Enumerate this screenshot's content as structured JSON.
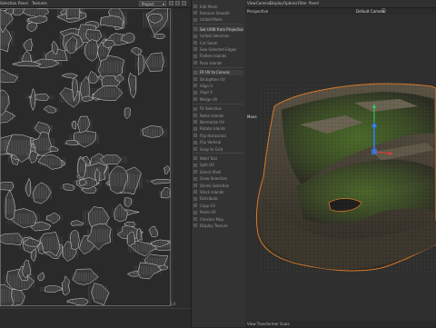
{
  "uv_editor": {
    "menu": [
      "Selection",
      "Panel",
      "Textures"
    ],
    "dropdown_value": "Project",
    "coord_label": "1.0"
  },
  "tools": [
    {
      "label": "Edit Mesh",
      "highlight": false
    },
    {
      "label": "Remove Smooth",
      "highlight": false
    },
    {
      "label": "Unfold Mesh",
      "highlight": false
    },
    {
      "label": "Set UVW from Projection",
      "highlight": true
    },
    {
      "label": "Unfold Selection",
      "highlight": false
    },
    {
      "label": "Cut Seam",
      "highlight": false
    },
    {
      "label": "Sew Selected Edges",
      "highlight": false
    },
    {
      "label": "Flatten Islands",
      "highlight": false
    },
    {
      "label": "Pack Islands",
      "highlight": false
    },
    {
      "label": "Fit UV to Canvas",
      "highlight": true
    },
    {
      "label": "Straighten UV",
      "highlight": false
    },
    {
      "label": "Align U",
      "highlight": false
    },
    {
      "label": "Align V",
      "highlight": false
    },
    {
      "label": "Merge UV",
      "highlight": false
    },
    {
      "label": "Fit Selection",
      "highlight": false
    },
    {
      "label": "Relax Islands",
      "highlight": false
    },
    {
      "label": "Normalize UV",
      "highlight": false
    },
    {
      "label": "Rotate Islands",
      "highlight": false
    },
    {
      "label": "Flip Horizontal",
      "highlight": false
    },
    {
      "label": "Flip Vertical",
      "highlight": false
    },
    {
      "label": "Snap to Grid",
      "highlight": false
    },
    {
      "label": "Weld Tool",
      "highlight": false
    },
    {
      "label": "Split UV",
      "highlight": false
    },
    {
      "label": "Select Shell",
      "highlight": false
    },
    {
      "label": "Grow Selection",
      "highlight": false
    },
    {
      "label": "Shrink Selection",
      "highlight": false
    },
    {
      "label": "Stack Islands",
      "highlight": false
    },
    {
      "label": "Distribute",
      "highlight": false
    },
    {
      "label": "Copy UV",
      "highlight": false
    },
    {
      "label": "Paste UV",
      "highlight": false
    },
    {
      "label": "Checker Map",
      "highlight": false
    },
    {
      "label": "Display Texture",
      "highlight": false
    }
  ],
  "viewport": {
    "menu": [
      "View",
      "Camera",
      "Display",
      "Options",
      "Filter",
      "Panel"
    ],
    "perspective_label": "Perspective",
    "camera_label": "Default Camera",
    "move_label": "Move",
    "status_text": "View Transformer Scale"
  },
  "colors": {
    "uv_wire": "#d8d8d8",
    "selection_orange": "#d8782a",
    "gizmo_green": "#2fcf5f",
    "gizmo_blue": "#2f7fff",
    "gizmo_red": "#e03a3a"
  }
}
